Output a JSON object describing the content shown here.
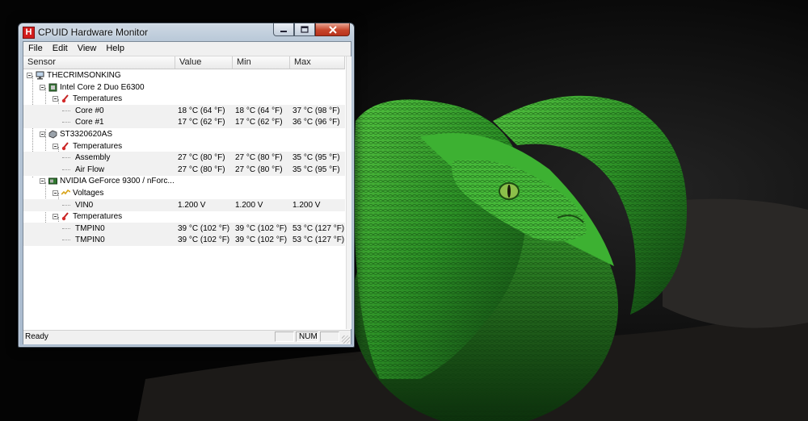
{
  "window": {
    "title": "CPUID Hardware Monitor",
    "icon_letter": "H"
  },
  "menu": [
    "File",
    "Edit",
    "View",
    "Help"
  ],
  "columns": [
    "Sensor",
    "Value",
    "Min",
    "Max"
  ],
  "tree": [
    {
      "level": 0,
      "kind": "computer",
      "label": "THECRIMSONKING",
      "value": "",
      "min": "",
      "max": ""
    },
    {
      "level": 1,
      "kind": "cpu",
      "label": "Intel Core 2 Duo E6300",
      "value": "",
      "min": "",
      "max": ""
    },
    {
      "level": 2,
      "kind": "temperature",
      "label": "Temperatures",
      "value": "",
      "min": "",
      "max": ""
    },
    {
      "level": 3,
      "kind": "sensor",
      "label": "Core #0",
      "value": "18 °C  (64 °F)",
      "min": "18 °C  (64 °F)",
      "max": "37 °C  (98 °F)"
    },
    {
      "level": 3,
      "kind": "sensor",
      "label": "Core #1",
      "value": "17 °C  (62 °F)",
      "min": "17 °C  (62 °F)",
      "max": "36 °C  (96 °F)"
    },
    {
      "level": 1,
      "kind": "drive",
      "label": "ST3320620AS",
      "value": "",
      "min": "",
      "max": ""
    },
    {
      "level": 2,
      "kind": "temperature",
      "label": "Temperatures",
      "value": "",
      "min": "",
      "max": ""
    },
    {
      "level": 3,
      "kind": "sensor",
      "label": "Assembly",
      "value": "27 °C  (80 °F)",
      "min": "27 °C  (80 °F)",
      "max": "35 °C  (95 °F)"
    },
    {
      "level": 3,
      "kind": "sensor",
      "label": "Air Flow",
      "value": "27 °C  (80 °F)",
      "min": "27 °C  (80 °F)",
      "max": "35 °C  (95 °F)"
    },
    {
      "level": 1,
      "kind": "gpu",
      "label": "NVIDIA GeForce 9300 / nForc...",
      "value": "",
      "min": "",
      "max": ""
    },
    {
      "level": 2,
      "kind": "voltage",
      "label": "Voltages",
      "value": "",
      "min": "",
      "max": ""
    },
    {
      "level": 3,
      "kind": "sensor",
      "label": "VIN0",
      "value": "1.200 V",
      "min": "1.200 V",
      "max": "1.200 V"
    },
    {
      "level": 2,
      "kind": "temperature",
      "label": "Temperatures",
      "value": "",
      "min": "",
      "max": ""
    },
    {
      "level": 3,
      "kind": "sensor",
      "label": "TMPIN0",
      "value": "39 °C  (102 °F)",
      "min": "39 °C  (102 °F)",
      "max": "53 °C  (127 °F)"
    },
    {
      "level": 3,
      "kind": "sensor",
      "label": "TMPIN0",
      "value": "39 °C  (102 °F)",
      "min": "39 °C  (102 °F)",
      "max": "53 °C  (127 °F)"
    }
  ],
  "statusbar": {
    "text": "Ready",
    "num": "NUM"
  },
  "colors": {
    "accent_red": "#d21d1d",
    "snake_green": "#2f9a2f"
  }
}
